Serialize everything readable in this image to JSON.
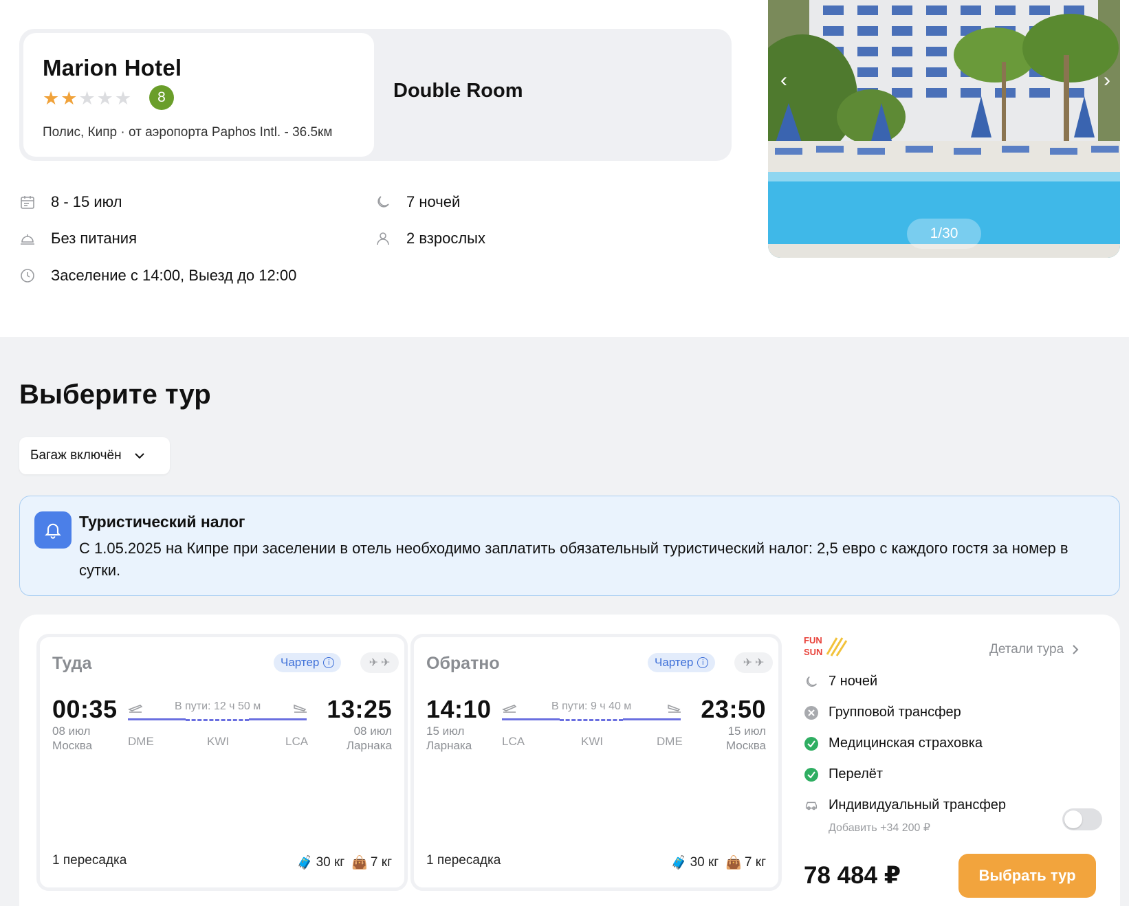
{
  "hotel": {
    "name": "Marion Hotel",
    "stars": 2,
    "stars_max": 5,
    "rating": "8",
    "location": "Полис, Кипр · от аэропорта Paphos Intl. - 36.5км",
    "room": "Double Room"
  },
  "info": {
    "dates": "8 - 15 июл",
    "nights": "7 ночей",
    "meal": "Без питания",
    "guests": "2 взрослых",
    "checkin": "Заселение с 14:00, Выезд до 12:00"
  },
  "photo": {
    "counter": "1/30"
  },
  "section": {
    "title": "Выберите тур",
    "filter_label": "Багаж включён"
  },
  "notice": {
    "title": "Туристический налог",
    "text": "С 1.05.2025 на Кипре при заселении в отель необходимо заплатить обязательный туристический налог: 2,5 евро с каждого гостя за номер в сутки."
  },
  "outbound": {
    "title": "Туда",
    "charter": "Чартер",
    "dep_time": "00:35",
    "dep_date": "08 июл",
    "dep_city": "Москва",
    "arr_time": "13:25",
    "arr_date": "08 июл",
    "arr_city": "Ларнака",
    "duration": "В пути: 12 ч 50 м",
    "airports": [
      "DME",
      "KWI",
      "LCA"
    ],
    "transfers": "1 пересадка",
    "baggage": "30 кг",
    "hand_luggage": "7 кг"
  },
  "return": {
    "title": "Обратно",
    "charter": "Чартер",
    "dep_time": "14:10",
    "dep_date": "15 июл",
    "dep_city": "Ларнака",
    "arr_time": "23:50",
    "arr_date": "15 июл",
    "arr_city": "Москва",
    "duration": "В пути: 9 ч 40 м",
    "airports": [
      "LCA",
      "KWI",
      "DME"
    ],
    "transfers": "1 пересадка",
    "baggage": "30 кг",
    "hand_luggage": "7 кг"
  },
  "tour": {
    "operator_logo_text": "FUN&SUN",
    "details_label": "Детали тура",
    "nights": "7 ночей",
    "features": [
      {
        "label": "Групповой трансфер",
        "included": false
      },
      {
        "label": "Медицинская страховка",
        "included": true
      },
      {
        "label": "Перелёт",
        "included": true
      }
    ],
    "individual_transfer": "Индивидуальный трансфер",
    "individual_transfer_price": "Добавить +34 200 ₽",
    "individual_transfer_enabled": false,
    "price": "78 484 ₽",
    "select_label": "Выбрать тур"
  },
  "colors": {
    "accent": "#f2a43d",
    "rating": "#6a9e2a",
    "route": "#6a6fe0",
    "notice_bg": "#eaf3fd",
    "check": "#2fae62"
  }
}
